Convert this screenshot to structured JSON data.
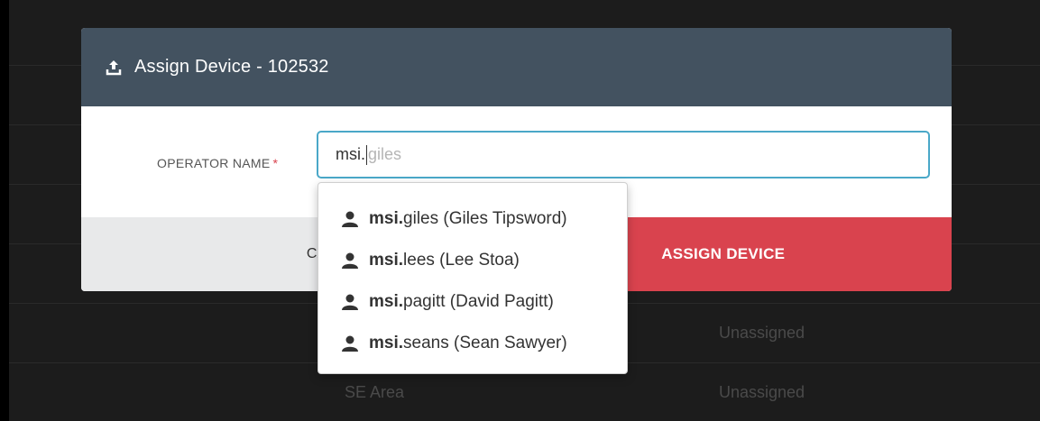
{
  "background_table": {
    "rows": [
      {
        "col1": "",
        "col2": "Unassigned"
      },
      {
        "col1": "SE Area",
        "col2": "Unassigned"
      }
    ]
  },
  "modal": {
    "title": "Assign Device - 102532",
    "field_label": "OPERATOR NAME",
    "required_marker": "*",
    "input": {
      "typed": "msi.",
      "autocomplete_hint": "giles"
    },
    "cancel_label": "CANCEL",
    "assign_label": "ASSIGN DEVICE"
  },
  "dropdown": {
    "items": [
      {
        "match": "msi.",
        "rest": "giles (Giles Tipsword)",
        "icon": "user-icon"
      },
      {
        "match": "msi.",
        "rest": "lees (Lee Stoa)",
        "icon": "user-icon"
      },
      {
        "match": "msi.",
        "rest": "pagitt (David Pagitt)",
        "icon": "user-icon"
      },
      {
        "match": "msi.",
        "rest": "seans (Sean Sawyer)",
        "icon": "user-icon"
      }
    ]
  },
  "colors": {
    "header": "#435260",
    "accent_red": "#d9434e",
    "focus_border": "#4aa8c8"
  }
}
